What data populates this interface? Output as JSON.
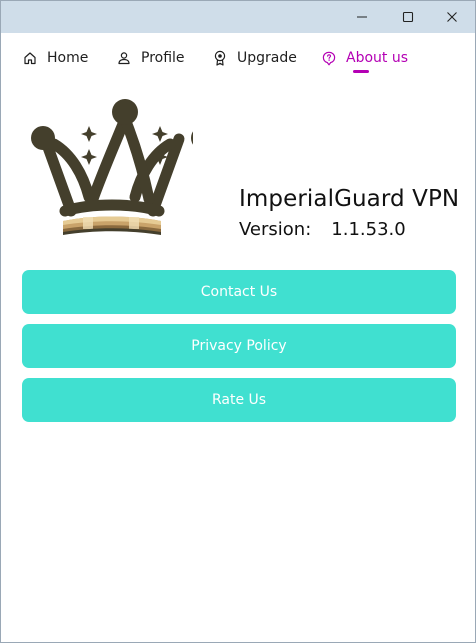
{
  "window": {
    "controls": {
      "minimize_icon": "minimize-icon",
      "maximize_icon": "maximize-icon",
      "close_icon": "close-icon"
    }
  },
  "nav": {
    "items": [
      {
        "label": "Home",
        "icon": "home-icon",
        "active": false
      },
      {
        "label": "Profile",
        "icon": "person-icon",
        "active": false
      },
      {
        "label": "Upgrade",
        "icon": "badge-icon",
        "active": false
      },
      {
        "label": "About us",
        "icon": "info-bubble-icon",
        "active": true
      }
    ],
    "active_color": "#b400b4"
  },
  "about": {
    "logo": "crown-logo",
    "app_name": "ImperialGuard VPN",
    "version_label": "Version:",
    "version_value": "1.1.53.0"
  },
  "actions": {
    "contact_label": "Contact Us",
    "privacy_label": "Privacy Policy",
    "rate_label": "Rate Us",
    "button_color": "#40e0d0"
  }
}
